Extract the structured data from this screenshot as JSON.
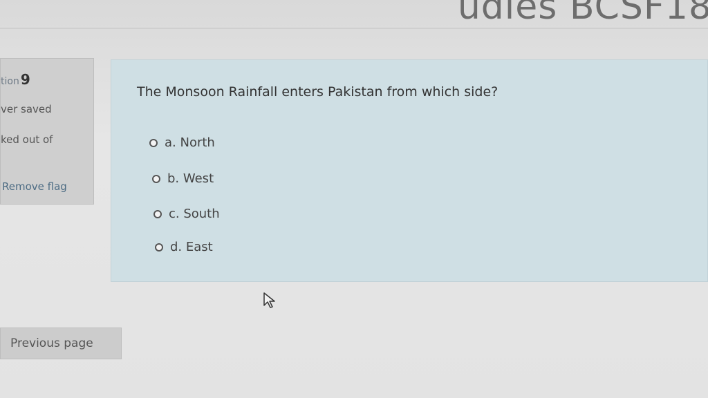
{
  "header": {
    "title": "udies BCSF18"
  },
  "info": {
    "question_prefix": "tion",
    "question_number": "9",
    "saved": "ver saved",
    "marked": "ked out of",
    "flag_label": "Remove flag"
  },
  "question": {
    "text": "The Monsoon Rainfall enters Pakistan from which side?",
    "options": [
      {
        "label": "a. North"
      },
      {
        "label": "b. West"
      },
      {
        "label": "c. South"
      },
      {
        "label": "d. East"
      }
    ]
  },
  "navigation": {
    "previous_label": "Previous page"
  },
  "icons": {
    "cursor": "mouse-pointer-icon",
    "radio": "radio-button-icon"
  }
}
